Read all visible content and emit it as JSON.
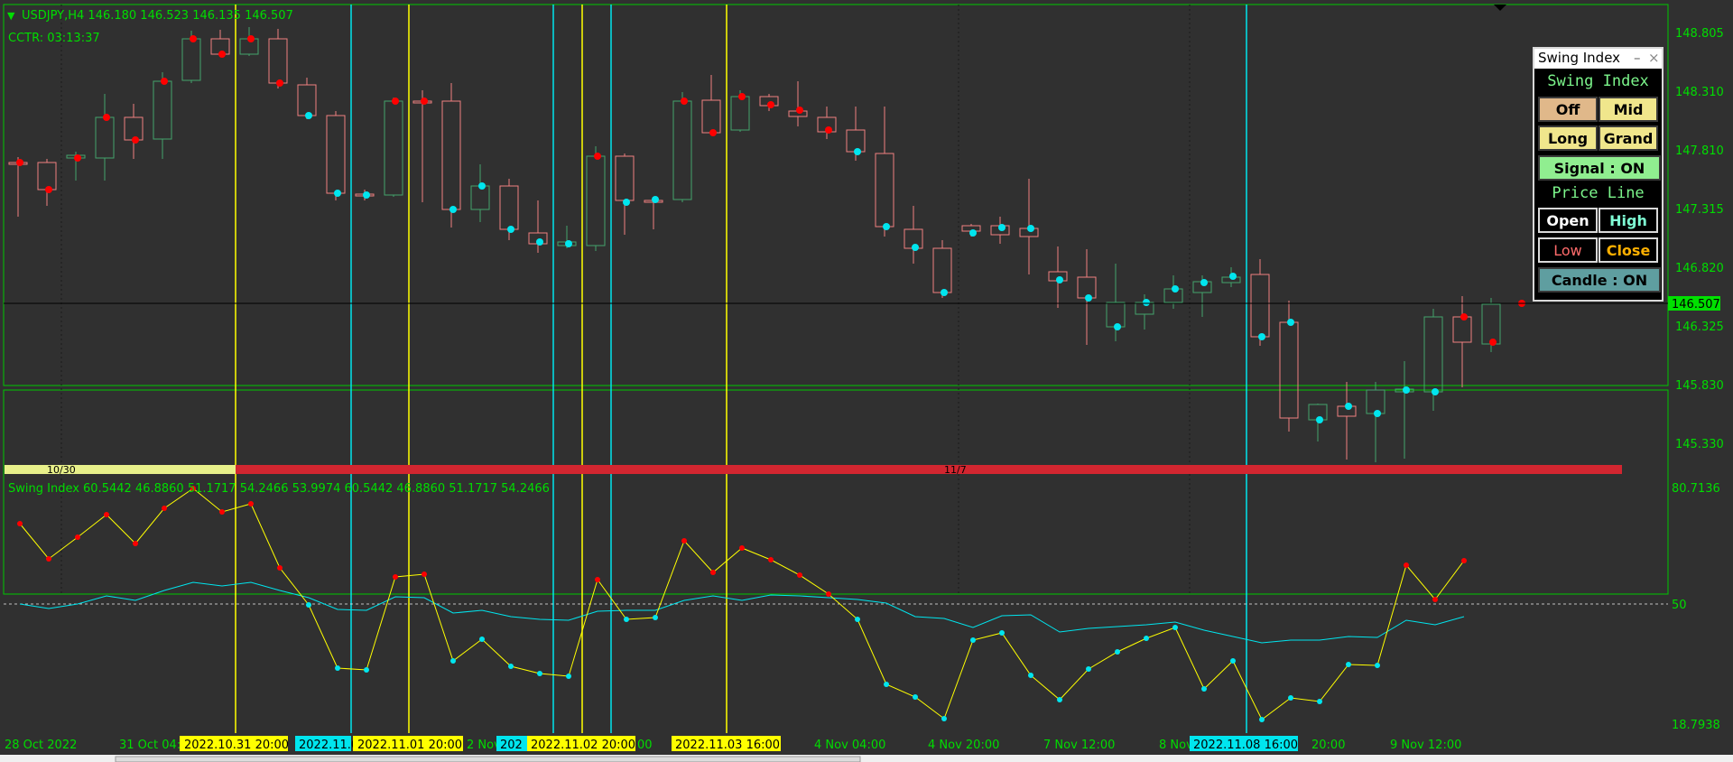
{
  "symbol_header": "USDJPY,H4  146.180 146.523 146.135 146.507",
  "countdown": "CCTR: 03:13:37",
  "price_axis": [
    "148.805",
    "148.310",
    "147.810",
    "147.315",
    "146.820",
    "146.325",
    "145.830",
    "145.330"
  ],
  "current_price": "146.507",
  "day_bar": {
    "left_label": "10/30",
    "right_label": "11/7"
  },
  "indicator_header": "Swing Index 60.5442 46.8860 51.1717 54.2466 53.9974 60.5442 46.8860 51.1717 54.2466",
  "indicator_axis": {
    "top": "80.7136",
    "mid": "50",
    "bottom": "18.7938"
  },
  "time_axis": [
    {
      "text": "28 Oct 2022"
    },
    {
      "text": "31 Oct 04:"
    },
    {
      "text": "2 Nov"
    },
    {
      "text": "00"
    },
    {
      "text": "4 Nov 04:00"
    },
    {
      "text": "4 Nov 20:00"
    },
    {
      "text": "7 Nov 12:00"
    },
    {
      "text": "8 Nov"
    },
    {
      "text": "20:00"
    },
    {
      "text": "9 Nov 12:00"
    }
  ],
  "time_tags": [
    {
      "text": "2022.10.31 20:00",
      "color": "#ffff00"
    },
    {
      "text": "2022.11.0",
      "color": "#00e5ee"
    },
    {
      "text": "2022.11.01 20:00",
      "color": "#ffff00"
    },
    {
      "text": "202",
      "color": "#00e5ee"
    },
    {
      "text": "2022.11.02 20:00",
      "color": "#ffff00"
    },
    {
      "text": "2022.11.03 16:00",
      "color": "#ffff00"
    },
    {
      "text": "2022.11.08 16:00",
      "color": "#00e5ee"
    }
  ],
  "panel": {
    "title": "Swing Index",
    "header1": "Swing Index",
    "buttons": [
      {
        "label": "Off",
        "bg": "#e0b88a",
        "fg": "#000000"
      },
      {
        "label": "Mid",
        "bg": "#f0e68c",
        "fg": "#000000"
      },
      {
        "label": "Long",
        "bg": "#f0e68c",
        "fg": "#000000"
      },
      {
        "label": "Grand",
        "bg": "#f0e68c",
        "fg": "#000000"
      }
    ],
    "signal": "Signal : ON",
    "header2": "Price Line",
    "price_buttons": [
      {
        "label": "Open",
        "fg": "#ffffff"
      },
      {
        "label": "High",
        "fg": "#7fffd4"
      },
      {
        "label": "Low",
        "fg": "#ff6b6b"
      },
      {
        "label": "Close",
        "fg": "#ffb000"
      }
    ],
    "candle": "Candle : ON"
  },
  "colors": {
    "background": "#303030",
    "up": "#43a36b",
    "down": "#f08080",
    "yellow": "#ffff00",
    "cyan": "#00e5ee",
    "dot_red": "#ff0000",
    "dot_cyan": "#00e5ee",
    "axis_text": "#00dd00",
    "day_bar_yellow": "#e8f08a",
    "day_bar_red": "#d22630"
  },
  "icons": {
    "close": "close-icon",
    "minimize": "minimize-icon",
    "dropdown": "triangle-down-icon"
  }
}
